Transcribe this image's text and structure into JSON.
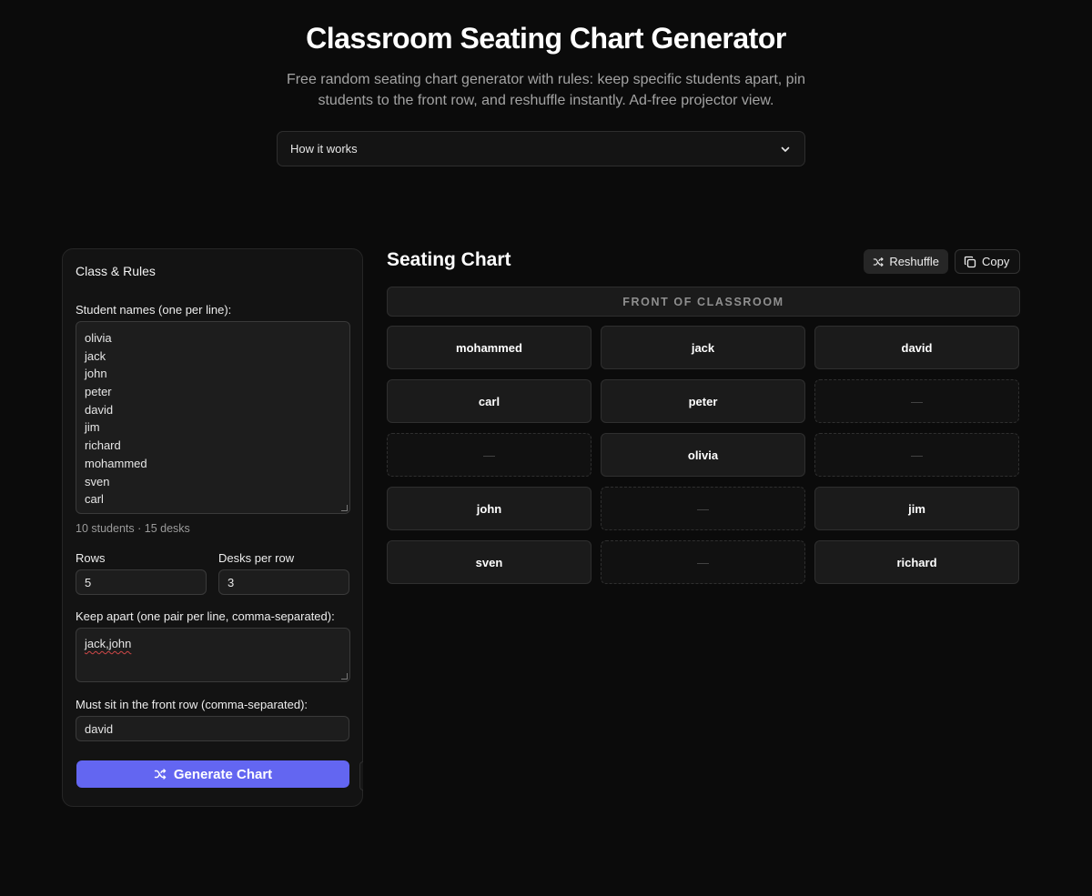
{
  "header": {
    "title": "Classroom Seating Chart Generator",
    "subtitle": "Free random seating chart generator with rules: keep specific students apart, pin students to the front row, and reshuffle instantly. Ad-free projector view.",
    "accordion_label": "How it works"
  },
  "panel": {
    "title": "Class & Rules",
    "names_label": "Student names (one per line):",
    "names": [
      "olivia",
      "jack",
      "john",
      "peter",
      "david",
      "jim",
      "richard",
      "mohammed",
      "sven",
      "carl"
    ],
    "summary": "10 students · 15 desks",
    "rows_label": "Rows",
    "rows_value": "5",
    "desks_label": "Desks per row",
    "desks_value": "3",
    "keep_apart_label": "Keep apart (one pair per line, comma-separated):",
    "keep_apart_value": "jack,john",
    "front_row_label": "Must sit in the front row (comma-separated):",
    "front_row_value": "david",
    "generate_label": "Generate Chart"
  },
  "chart": {
    "title": "Seating Chart",
    "reshuffle_label": "Reshuffle",
    "copy_label": "Copy",
    "front_label": "FRONT OF CLASSROOM",
    "empty_marker": "—",
    "rows": [
      [
        "mohammed",
        "jack",
        "david"
      ],
      [
        "carl",
        "peter",
        ""
      ],
      [
        "",
        "olivia",
        ""
      ],
      [
        "john",
        "",
        "jim"
      ],
      [
        "sven",
        "",
        "richard"
      ]
    ]
  }
}
